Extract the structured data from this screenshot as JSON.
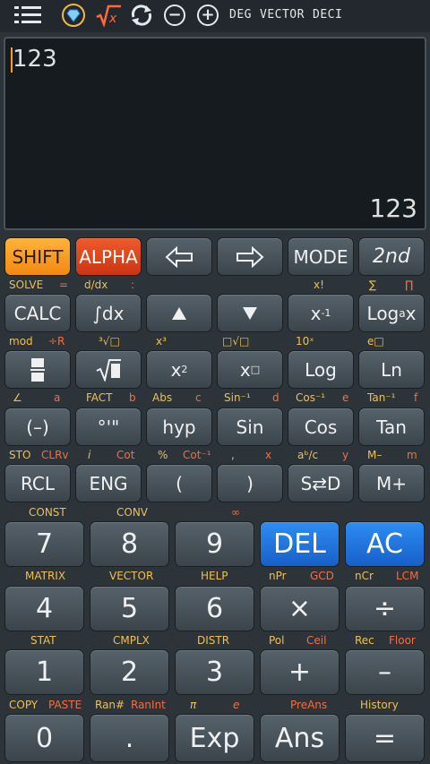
{
  "topbar": {
    "menu_icon": "hamburger-menu-icon",
    "deg": "DEG",
    "vector": "VECTOR",
    "deci": "DECI"
  },
  "display": {
    "expression": "123",
    "result": "123"
  },
  "row1": {
    "shift": "SHIFT",
    "alpha": "ALPHA",
    "mode": "MODE",
    "second": "2nd"
  },
  "row1_labels": {
    "solve": "SOLVE",
    "eq": "=",
    "ddx": "d/dx",
    "colon": ":",
    "xfact": "x!",
    "sum": "∑",
    "prod": "∏"
  },
  "row2": {
    "calc": "CALC",
    "integ": "∫dx"
  },
  "row2_labels": {
    "mod": "mod",
    "divR": "÷R",
    "cuberoot": "³√□",
    "xcube": "x³",
    "nroot": "□√□",
    "tenx": "10ˣ",
    "epow": "e□"
  },
  "row3": {
    "log": "Log",
    "ln": "Ln"
  },
  "row3_labels": {
    "angle": "∠",
    "a": "a",
    "fact": "FACT",
    "b": "b",
    "abs": "Abs",
    "c": "c",
    "asin": "Sin⁻¹",
    "d": "d",
    "acos": "Cos⁻¹",
    "e": "e",
    "atan": "Tan⁻¹",
    "f": "f"
  },
  "row4": {
    "neg": "(–)",
    "dms": "°'\"",
    "hyp": "hyp",
    "sin": "Sin",
    "cos": "Cos",
    "tan": "Tan"
  },
  "row4_labels": {
    "sto": "STO",
    "clrv": "CLRv",
    "i": "i",
    "cot": "Cot",
    "pct": "%",
    "acot": "Cot⁻¹",
    "comma": ",",
    "x": "x",
    "abc": "aᵇ/c",
    "y": "y",
    "mminus": "M–",
    "m": "m"
  },
  "row5": {
    "rcl": "RCL",
    "eng": "ENG",
    "lparen": "(",
    "rparen": ")",
    "sd": "S⇄D",
    "mplus": "M+"
  },
  "row5_labels": {
    "const": "CONST",
    "conv": "CONV",
    "inf": "∞"
  },
  "row6": {
    "seven": "7",
    "eight": "8",
    "nine": "9",
    "del": "DEL",
    "ac": "AC"
  },
  "row6_labels": {
    "matrix": "MATRIX",
    "vector": "VECTOR",
    "help": "HELP",
    "npr": "nPr",
    "gcd": "GCD",
    "ncr": "nCr",
    "lcm": "LCM"
  },
  "row7": {
    "four": "4",
    "five": "5",
    "six": "6",
    "mul": "×",
    "div": "÷"
  },
  "row7_labels": {
    "stat": "STAT",
    "cmplx": "CMPLX",
    "distr": "DISTR",
    "pol": "Pol",
    "ceil": "Ceil",
    "rec": "Rec",
    "floor": "Floor"
  },
  "row8": {
    "one": "1",
    "two": "2",
    "three": "3",
    "plus": "+",
    "minus": "–"
  },
  "row8_labels": {
    "copy": "COPY",
    "paste": "PASTE",
    "ran": "Ran#",
    "ranint": "RanInt",
    "pi": "π",
    "e": "e",
    "preans": "PreAns",
    "history": "History"
  },
  "row9": {
    "zero": "0",
    "dot": ".",
    "exp": "Exp",
    "ans": "Ans",
    "equals": "="
  },
  "colors": {
    "shift": "#f59a20",
    "alpha": "#d9431c",
    "blue": "#1f74e0",
    "label_yellow": "#f2c04a",
    "label_orange": "#ff6a3a"
  }
}
